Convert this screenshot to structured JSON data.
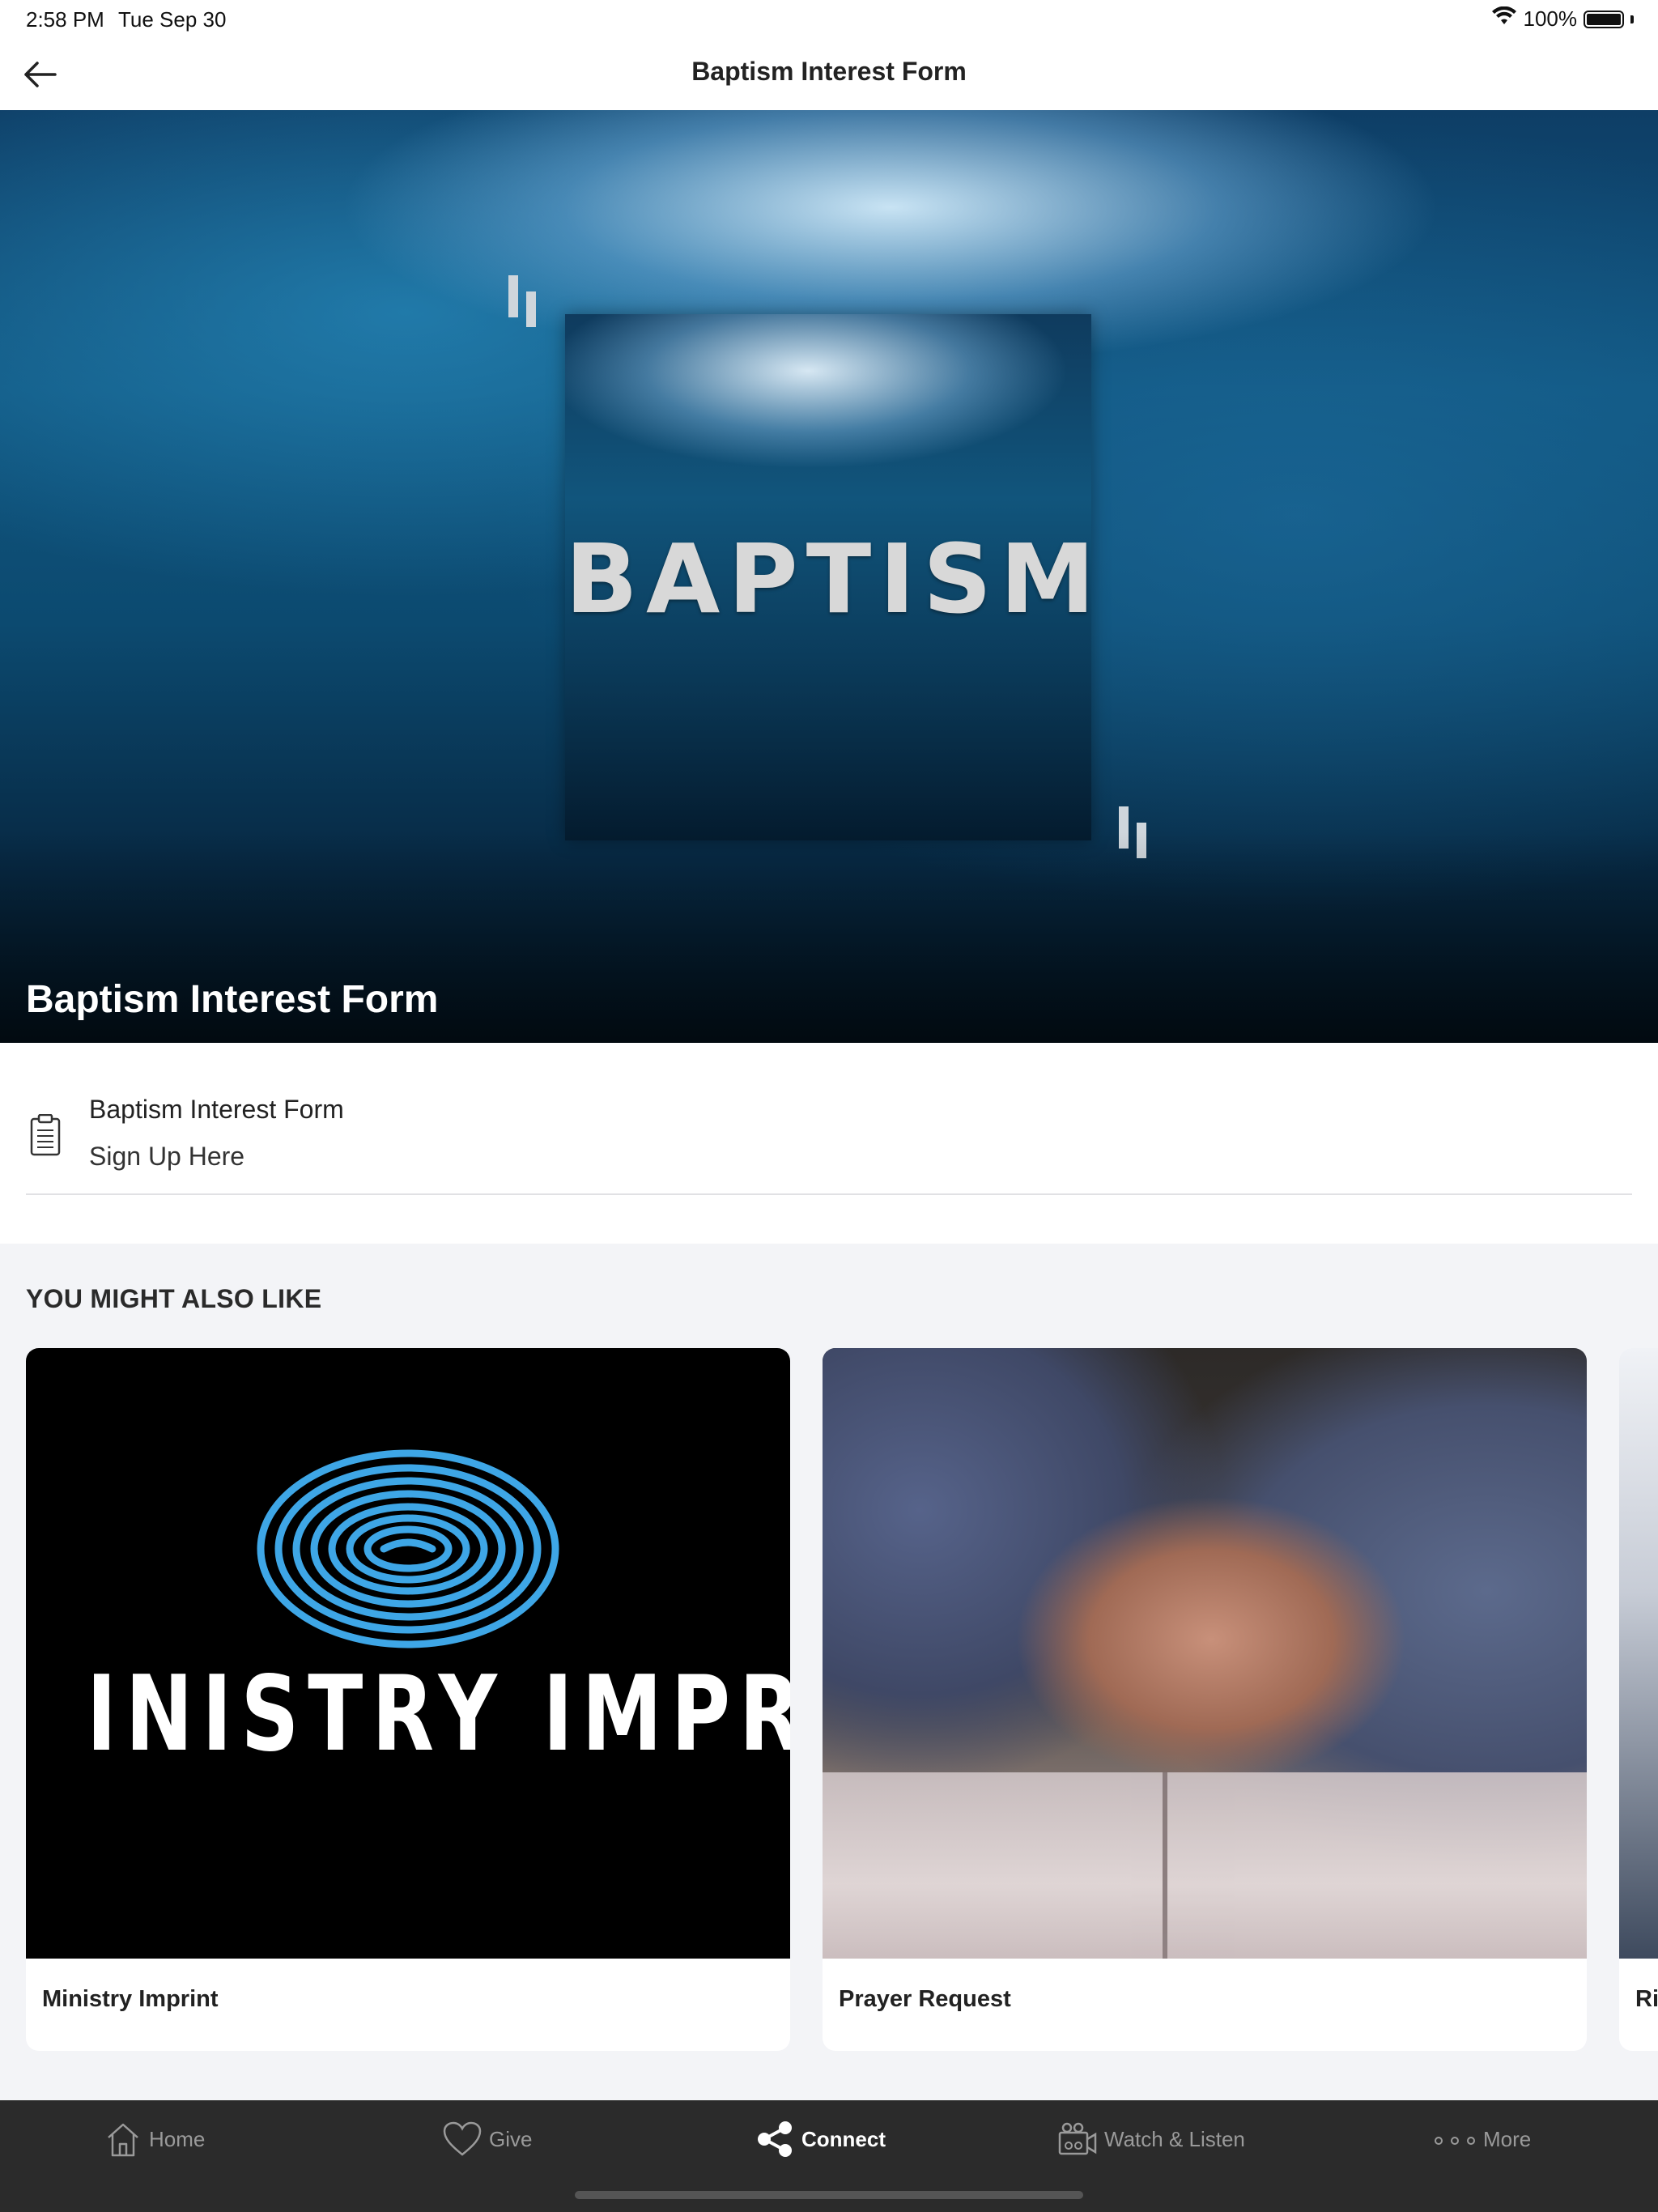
{
  "status_bar": {
    "time": "2:58 PM",
    "date": "Tue Sep 30",
    "battery_percent": "100%",
    "icons": [
      "wifi-icon",
      "battery-icon"
    ]
  },
  "nav": {
    "title": "Baptism Interest Form",
    "back_icon": "arrow-left-icon"
  },
  "hero": {
    "overlay_title": "Baptism Interest Form",
    "image_text": "BAPTISM"
  },
  "form_item": {
    "icon": "clipboard-icon",
    "title": "Baptism Interest Form",
    "subtitle": "Sign Up Here"
  },
  "also_like": {
    "heading": "YOU MIGHT ALSO LIKE",
    "cards": [
      {
        "label": "Ministry Imprint",
        "image_text": "INISTRY IMPRIN",
        "fingerprint_color": "#3ea6e6"
      },
      {
        "label": "Prayer Request"
      },
      {
        "label": "Ri"
      }
    ]
  },
  "tab_bar": {
    "tabs": [
      {
        "label": "Home",
        "icon": "home-icon",
        "active": false
      },
      {
        "label": "Give",
        "icon": "heart-icon",
        "active": false
      },
      {
        "label": "Connect",
        "icon": "share-icon",
        "active": true
      },
      {
        "label": "Watch & Listen",
        "icon": "video-camera-icon",
        "active": false
      },
      {
        "label": "More",
        "icon": "more-dots-icon",
        "active": false
      }
    ]
  },
  "colors": {
    "tab_bar_bg": "#2b2b2b",
    "active_tab": "#ffffff",
    "inactive_tab": "#9a9a9a",
    "page_bg": "#f3f4f7"
  }
}
